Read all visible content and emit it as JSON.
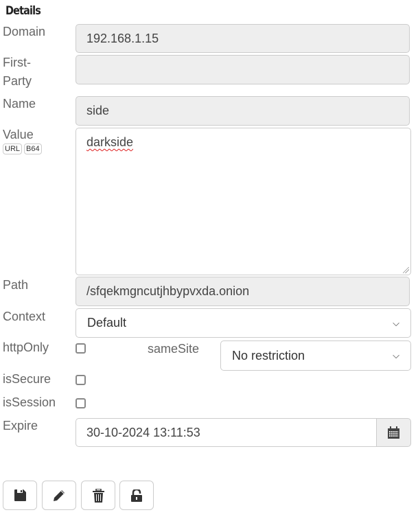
{
  "title": "Details",
  "fields": {
    "domain": {
      "label": "Domain",
      "value": "192.168.1.15"
    },
    "first_party": {
      "label_line1": "First-",
      "label_line2": "Party",
      "value": ""
    },
    "name": {
      "label": "Name",
      "value": "side"
    },
    "value": {
      "label": "Value",
      "value": "darkside",
      "url_chip": "URL",
      "b64_chip": "B64"
    },
    "path": {
      "label": "Path",
      "value": "/sfqekmgncutjhbypvxda.onion"
    },
    "context": {
      "label": "Context",
      "selected": "Default"
    },
    "http_only": {
      "label": "httpOnly",
      "checked": false
    },
    "same_site": {
      "label": "sameSite",
      "selected": "No restriction"
    },
    "is_secure": {
      "label": "isSecure",
      "checked": false
    },
    "is_session": {
      "label": "isSession",
      "checked": false
    },
    "expire": {
      "label": "Expire",
      "value": "30-10-2024 13:11:53"
    }
  },
  "icons": {
    "chevron": "⌄",
    "save": "save-icon",
    "edit": "pencil-icon",
    "delete": "trash-icon",
    "protect": "unlock-icon",
    "calendar": "calendar-icon"
  }
}
